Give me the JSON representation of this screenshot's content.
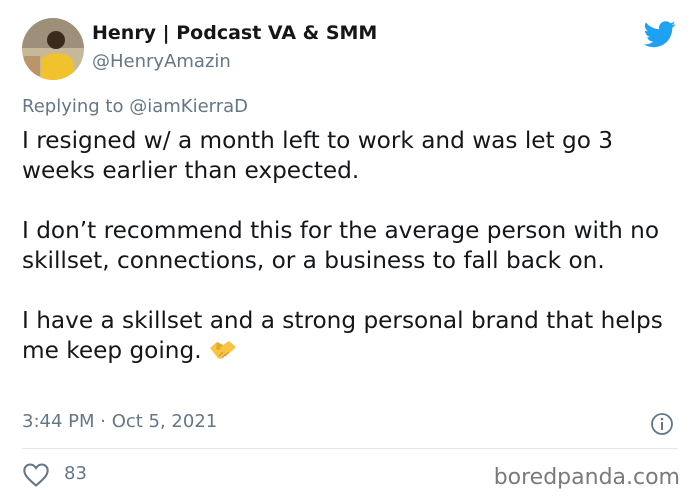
{
  "tweet": {
    "display_name": "Henry | Podcast VA & SMM",
    "handle": "@HenryAmazin",
    "reply_prefix": "Replying to ",
    "reply_mention": "@iamKierraD",
    "paragraphs": [
      "I resigned w/ a month left to work and was let go 3 weeks earlier than expected.",
      "I don’t recommend this for the average person with no skillset, connections, or a business to fall back on.",
      "I have a skillset and a strong personal brand that helps me keep going."
    ],
    "emoji": "handshake-emoji",
    "timestamp": "3:44 PM · Oct 5, 2021",
    "like_count": "83"
  },
  "watermark": "boredpanda.com",
  "colors": {
    "twitter_blue": "#1da1f2",
    "muted_text": "#657786",
    "primary_text": "#14171a",
    "divider": "#e1e8ed"
  },
  "icons": {
    "logo": "twitter-bird-icon",
    "info": "info-icon",
    "like": "heart-icon"
  }
}
